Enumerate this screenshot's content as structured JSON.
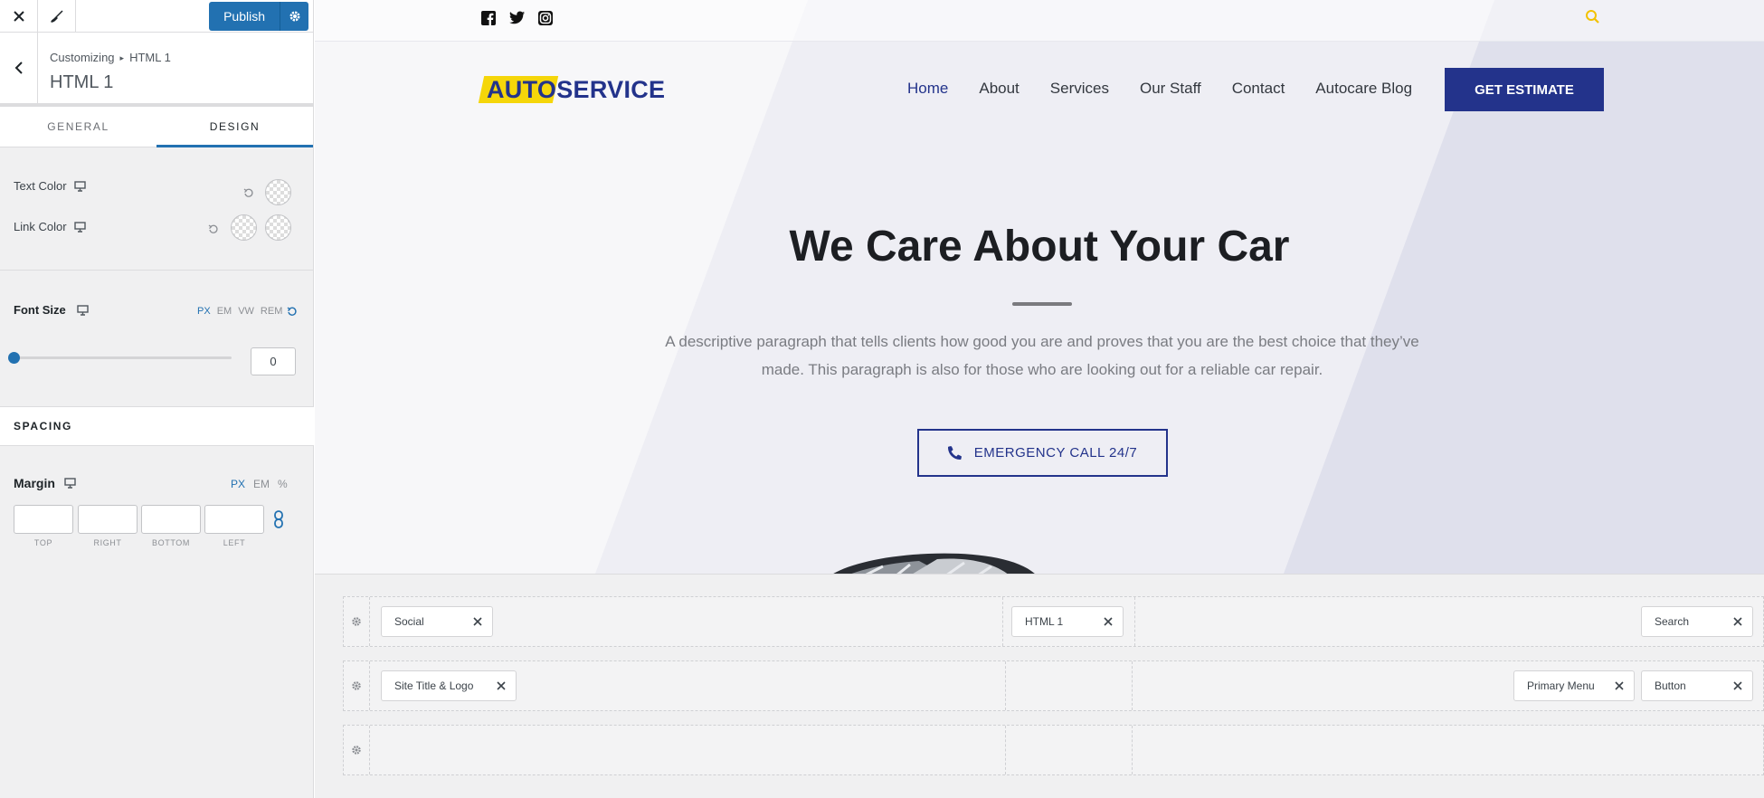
{
  "sidebar": {
    "publish_label": "Publish",
    "breadcrumb": {
      "root": "Customizing",
      "current": "HTML 1"
    },
    "section_title": "HTML 1",
    "tabs": [
      {
        "label": "GENERAL"
      },
      {
        "label": "DESIGN"
      }
    ],
    "active_tab": "DESIGN",
    "text_color_label": "Text Color",
    "link_color_label": "Link Color",
    "font_size": {
      "label": "Font Size",
      "units": [
        "PX",
        "EM",
        "VW",
        "REM"
      ],
      "active_unit": "PX",
      "value": "0",
      "slider_level": 0
    },
    "spacing_label": "SPACING",
    "margin": {
      "label": "Margin",
      "units": [
        "PX",
        "EM",
        "%"
      ],
      "active_unit": "PX",
      "fields": [
        {
          "label": "TOP",
          "value": ""
        },
        {
          "label": "RIGHT",
          "value": ""
        },
        {
          "label": "BOTTOM",
          "value": ""
        },
        {
          "label": "LEFT",
          "value": ""
        }
      ]
    }
  },
  "preview": {
    "social": [
      "facebook-icon",
      "twitter-icon",
      "instagram-icon"
    ],
    "logo": {
      "part1": "AUTO",
      "part2": "SERVICE"
    },
    "nav": [
      "Home",
      "About",
      "Services",
      "Our Staff",
      "Contact",
      "Autocare Blog"
    ],
    "active_nav": "Home",
    "cta_label": "GET ESTIMATE",
    "hero_title": "We Care About Your Car",
    "hero_text": "A descriptive paragraph that tells clients how good you are and proves that you are the best choice that they’ve made. This paragraph is also for those who are looking out for a reliable car repair.",
    "emergency_label": "EMERGENCY CALL 24/7",
    "colors": {
      "brand": "#23338b",
      "logo_highlight": "#f5d60a",
      "accent": "#2271b1",
      "search_icon": "#f2c200"
    }
  },
  "builder": {
    "row1": [
      "Social",
      "HTML 1",
      "Search"
    ],
    "row2": [
      "Site Title & Logo",
      "Primary Menu",
      "Button"
    ]
  }
}
